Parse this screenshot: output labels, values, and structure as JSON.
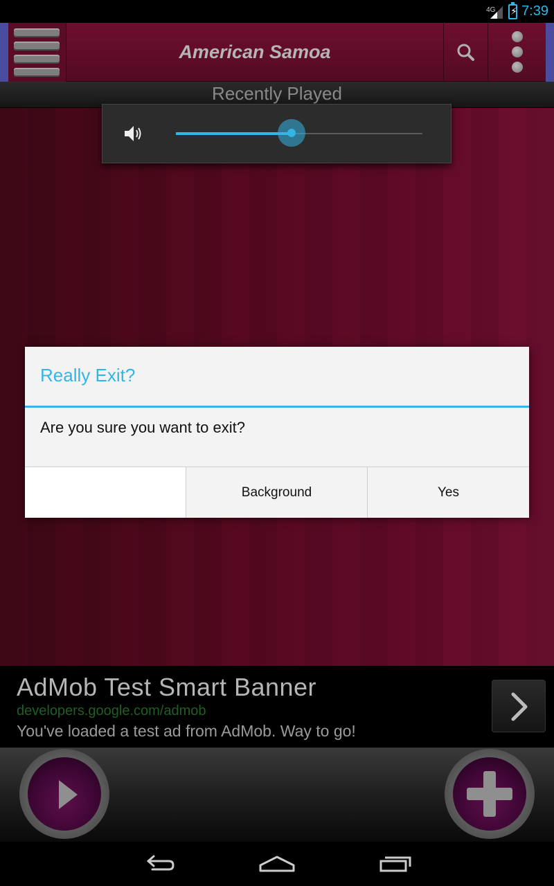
{
  "status_bar": {
    "network": "4G",
    "time": "7:39"
  },
  "app_bar": {
    "title": "American Samoa",
    "menu_icon": "hamburger-menu-icon",
    "search_icon": "search-icon",
    "overflow_icon": "overflow-menu-icon"
  },
  "section": {
    "label": "Recently Played"
  },
  "volume_panel": {
    "icon": "speaker-icon",
    "level": 0.47
  },
  "dialog": {
    "title": "Really Exit?",
    "message": "Are you sure you want to exit?",
    "buttons": [
      "",
      "Background",
      "Yes"
    ]
  },
  "ad": {
    "title": "AdMob Test Smart Banner",
    "url": "developers.google.com/admob",
    "description": "You've loaded a test ad from AdMob. Way to go!",
    "arrow_icon": "chevron-right-icon"
  },
  "controls": {
    "play_icon": "play-icon",
    "add_icon": "plus-icon"
  },
  "nav_bar": {
    "back_icon": "back-icon",
    "home_icon": "home-icon",
    "recents_icon": "recent-apps-icon"
  },
  "colors": {
    "accent": "#33b5e5",
    "app_bar": "#5a0b25",
    "content": "#55091f"
  }
}
